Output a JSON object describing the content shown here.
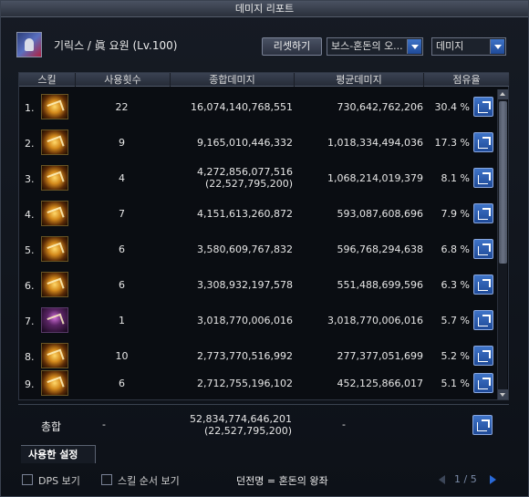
{
  "window": {
    "title": "데미지 리포트"
  },
  "header": {
    "character": "기릭스 / 眞 요원 (Lv.100)",
    "reset_label": "리셋하기",
    "target_select": "보스-혼돈의 오...",
    "type_select": "데미지"
  },
  "columns": [
    "스킬",
    "사용횟수",
    "종합데미지",
    "평균데미지",
    "점유율"
  ],
  "rows": [
    {
      "rank": "1.",
      "count": "22",
      "total": "16,074,140,768,551",
      "total_extra": "",
      "avg": "730,642,762,206",
      "share": "30.4 %"
    },
    {
      "rank": "2.",
      "count": "9",
      "total": "9,165,010,446,332",
      "total_extra": "",
      "avg": "1,018,334,494,036",
      "share": "17.3 %"
    },
    {
      "rank": "3.",
      "count": "4",
      "total": "4,272,856,077,516",
      "total_extra": "(22,527,795,200)",
      "avg": "1,068,214,019,379",
      "share": "8.1 %"
    },
    {
      "rank": "4.",
      "count": "7",
      "total": "4,151,613,260,872",
      "total_extra": "",
      "avg": "593,087,608,696",
      "share": "7.9 %"
    },
    {
      "rank": "5.",
      "count": "6",
      "total": "3,580,609,767,832",
      "total_extra": "",
      "avg": "596,768,294,638",
      "share": "6.8 %"
    },
    {
      "rank": "6.",
      "count": "6",
      "total": "3,308,932,197,578",
      "total_extra": "",
      "avg": "551,488,699,596",
      "share": "6.3 %"
    },
    {
      "rank": "7.",
      "count": "1",
      "total": "3,018,770,006,016",
      "total_extra": "",
      "avg": "3,018,770,006,016",
      "share": "5.7 %"
    },
    {
      "rank": "8.",
      "count": "10",
      "total": "2,773,770,516,992",
      "total_extra": "",
      "avg": "277,377,051,699",
      "share": "5.2 %"
    },
    {
      "rank": "9.",
      "count": "6",
      "total": "2,712,755,196,102",
      "total_extra": "",
      "avg": "452,125,866,017",
      "share": "5.1 %"
    }
  ],
  "summary": {
    "label": "총합",
    "count": "-",
    "total": "52,834,774,646,201",
    "total_extra": "(22,527,795,200)",
    "avg": "-"
  },
  "tab_label": "사용한 설정",
  "footer": {
    "dps_label": "DPS 보기",
    "order_label": "스킬 순서 보기",
    "dungeon": "던전명 = 혼돈의 왕좌",
    "page": "1 / 5"
  },
  "colors": {
    "accent": "#2a6ad8",
    "titlebar": "#3a4252"
  },
  "icons": [
    "skill-icon",
    "share-icon",
    "chevron-down-icon",
    "checkbox-icon",
    "arrow-right-icon"
  ]
}
